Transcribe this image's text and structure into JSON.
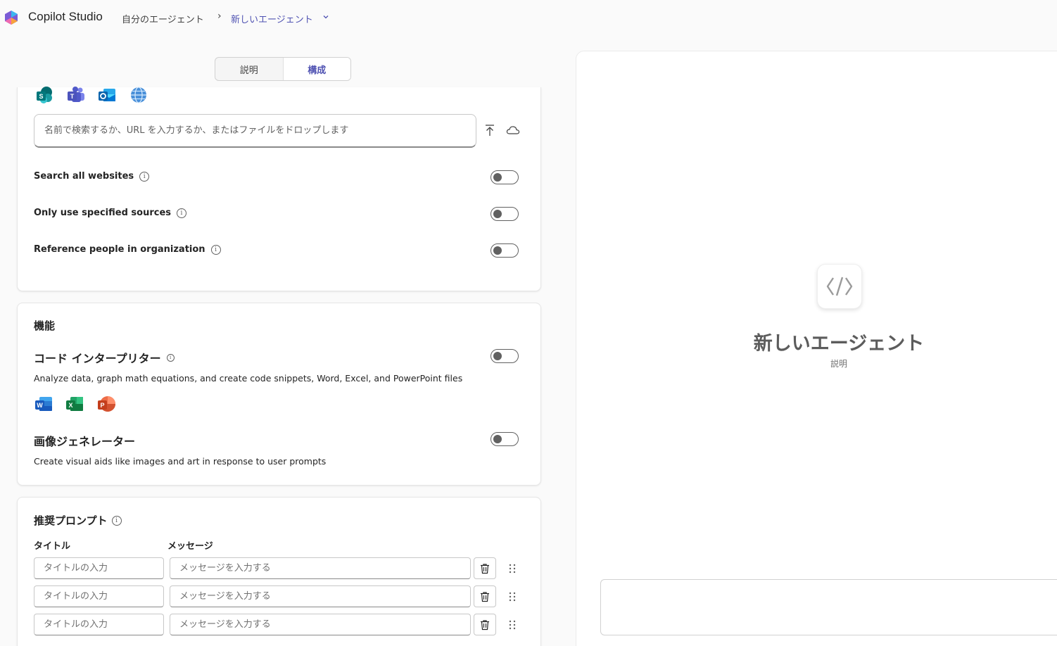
{
  "app": {
    "title": "Copilot Studio"
  },
  "breadcrumb": {
    "parent": "自分のエージェント",
    "separator": "›",
    "current": "新しいエージェント"
  },
  "tabs": [
    {
      "label": "説明",
      "active": false
    },
    {
      "label": "構成",
      "active": true
    }
  ],
  "knowledge": {
    "source_icons": [
      "sharepoint-icon",
      "teams-icon",
      "outlook-icon",
      "web-globe-icon"
    ],
    "search_placeholder": "名前で検索するか、URL を入力するか、またはファイルをドロップします",
    "toggles": [
      {
        "label": "Search all websites",
        "on": false
      },
      {
        "label": "Only use specified sources",
        "on": false
      },
      {
        "label": "Reference people in organization",
        "on": false
      }
    ]
  },
  "capabilities": {
    "title": "機能",
    "code_interpreter": {
      "title": "コード インタープリター",
      "description": "Analyze data, graph math equations, and create code snippets, Word, Excel, and PowerPoint files",
      "on": false,
      "icons": [
        "word-icon",
        "excel-icon",
        "powerpoint-icon"
      ]
    },
    "image_generator": {
      "title": "画像ジェネレーター",
      "description": "Create visual aids like images and art in response to user prompts",
      "on": false
    }
  },
  "prompts": {
    "title": "推奨プロンプト",
    "title_col": "タイトル",
    "message_col": "メッセージ",
    "title_placeholder": "タイトルの入力",
    "message_placeholder": "メッセージを入力する"
  },
  "preview": {
    "agent_name": "新しいエージェント",
    "agent_desc": "説明"
  },
  "colors": {
    "accent": "#4f52b2",
    "toggle_off": "#616161"
  }
}
